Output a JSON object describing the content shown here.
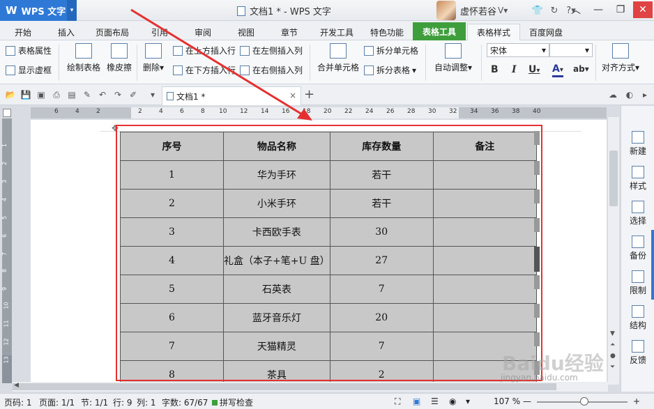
{
  "app": {
    "brand": "WPS 文字",
    "doc_title": "文档1 * - WPS 文字",
    "user_name": "虚怀若谷",
    "help_icon": "?"
  },
  "tabs": [
    "开始",
    "插入",
    "页面布局",
    "引用",
    "审阅",
    "视图",
    "章节",
    "开发工具",
    "特色功能",
    "表格工具",
    "表格样式",
    "百度网盘"
  ],
  "active_tab": "表格工具",
  "ribbon": {
    "table_props": "表格属性",
    "show_gridlines": "显示虚框",
    "draw_table": "绘制表格",
    "eraser": "橡皮擦",
    "delete": "删除",
    "insert_above": "在上方插入行",
    "insert_below": "在下方插入行",
    "insert_left": "在左侧插入列",
    "insert_right": "在右侧插入列",
    "merge_cells": "合并单元格",
    "split_cells": "拆分单元格",
    "split_table": "拆分表格",
    "autofit": "自动调整",
    "font_name": "宋体",
    "font_size": "",
    "bold": "B",
    "italic": "I",
    "underline": "U",
    "font_color": "A",
    "align": "对齐方式"
  },
  "quickbar": {
    "doc_tab": "文档1 *"
  },
  "ruler_labels": [
    "6",
    "4",
    "2",
    "2",
    "4",
    "6",
    "8",
    "10",
    "12",
    "14",
    "16",
    "18",
    "20",
    "22",
    "24",
    "26",
    "28",
    "30",
    "32",
    "34",
    "36",
    "38",
    "40"
  ],
  "vruler_labels": [
    "1",
    "2",
    "3",
    "4",
    "5",
    "6",
    "7",
    "8",
    "9",
    "10",
    "11",
    "12",
    "13"
  ],
  "table": {
    "headers": [
      "序号",
      "物品名称",
      "库存数量",
      "备注"
    ],
    "rows": [
      [
        "1",
        "华为手环",
        "若干",
        ""
      ],
      [
        "2",
        "小米手环",
        "若干",
        ""
      ],
      [
        "3",
        "卡西欧手表",
        "30",
        ""
      ],
      [
        "4",
        "礼盒（本子+笔+U 盘）",
        "27",
        ""
      ],
      [
        "5",
        "石英表",
        "7",
        ""
      ],
      [
        "6",
        "蓝牙音乐灯",
        "20",
        ""
      ],
      [
        "7",
        "天猫精灵",
        "7",
        ""
      ],
      [
        "8",
        "茶具",
        "2",
        ""
      ]
    ]
  },
  "side_panel": [
    "新建",
    "样式",
    "选择",
    "备份",
    "限制",
    "结构",
    "反馈"
  ],
  "status": {
    "page_no": "页码: 1",
    "pages": "页面: 1/1",
    "section": "节: 1/1",
    "row": "行: 9",
    "col": "列: 1",
    "words": "字数: 67/67",
    "spell": "拼写检查",
    "zoom": "107 %"
  },
  "watermark": {
    "brand": "Baidu经验",
    "url": "jingyan.baidu.com"
  },
  "colors": {
    "active_tab": "#3f9e3c",
    "app_button": "#2f79d6",
    "highlight_box": "#e53030",
    "table_fill": "#c8c8c8"
  }
}
